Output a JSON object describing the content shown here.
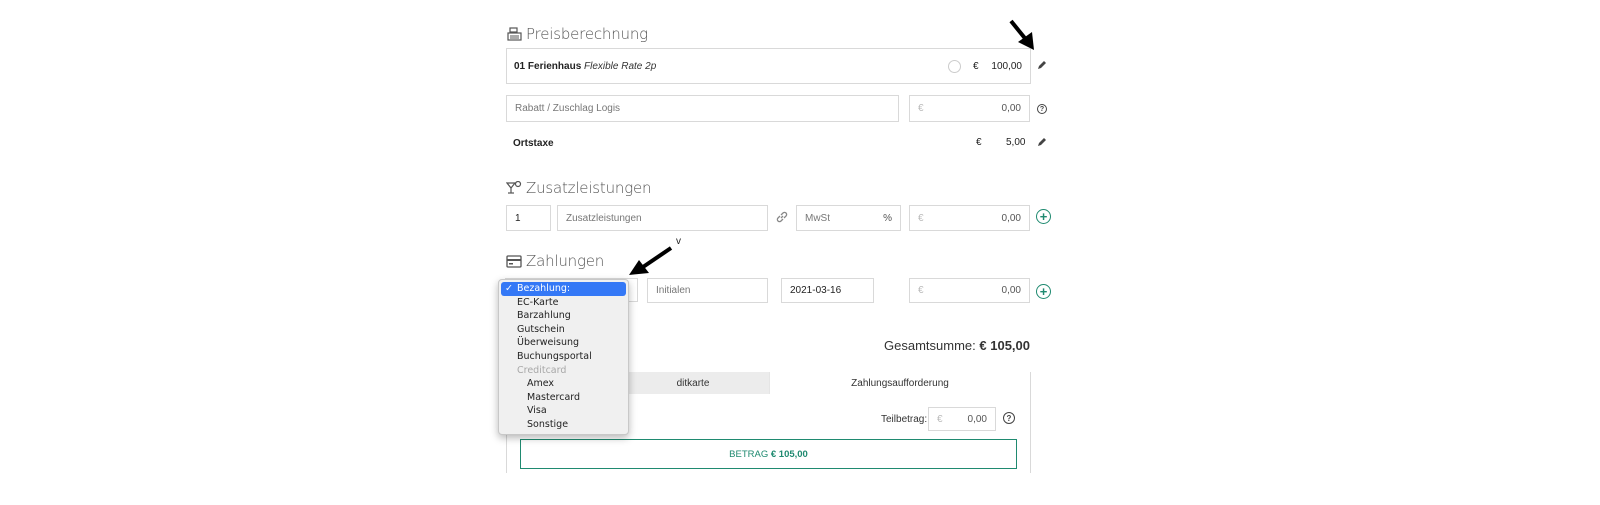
{
  "preis": {
    "title": "Preisberechnung",
    "unit_name": "01 Ferienhaus",
    "rate_name": "Flexible Rate 2p",
    "currency": "€",
    "amount": "100,00",
    "rabatt_placeholder": "Rabatt / Zuschlag Logis",
    "rabatt_currency": "€",
    "rabatt_value": "0,00",
    "ortstaxe_label": "Ortstaxe",
    "ortstaxe_currency": "€",
    "ortstaxe_value": "5,00"
  },
  "zusatz": {
    "title": "Zusatzleistungen",
    "qty": "1",
    "name_placeholder": "Zusatzleistungen",
    "mwst_placeholder": "MwSt",
    "percent": "%",
    "currency": "€",
    "value": "0,00"
  },
  "zahlungen": {
    "title": "Zahlungen",
    "initialen_placeholder": "Initialen",
    "date": "2021-03-16",
    "currency": "€",
    "value": "0,00"
  },
  "annotation": {
    "letter": "v"
  },
  "dropdown": {
    "selected": "Bezahlung:",
    "items": [
      "EC-Karte",
      "Barzahlung",
      "Gutschein",
      "Überweisung",
      "Buchungsportal"
    ],
    "group_label": "Creditcard",
    "sub_items": [
      "Amex",
      "Mastercard",
      "Visa",
      "Sonstige"
    ]
  },
  "summary": {
    "total_label": "Gesamtsumme:",
    "total_value": "€ 105,00",
    "tab_kreditkarte": "ditkarte",
    "tab_zahlungsaufforderung": "Zahlungsaufforderung",
    "teilbetrag_label": "Teilbetrag:",
    "teilbetrag_currency": "€",
    "teilbetrag_value": "0,00",
    "betrag_label": "BETRAG",
    "betrag_value": "€ 105,00"
  },
  "colors": {
    "accent": "#1f8a70",
    "selection": "#3478f6"
  }
}
